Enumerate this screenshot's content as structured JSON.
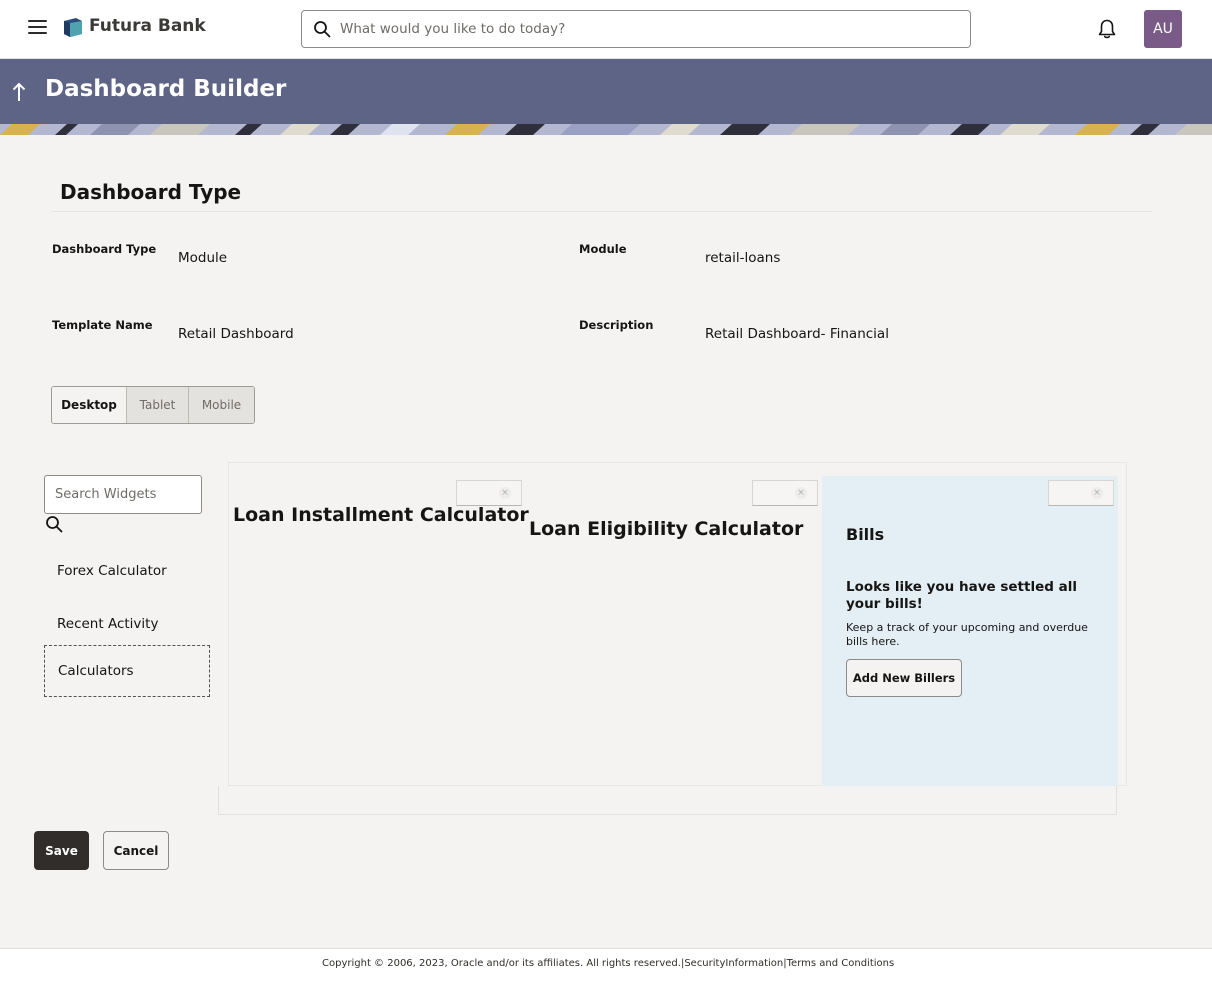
{
  "header": {
    "brand": "Futura Bank",
    "search_placeholder": "What would you like to do today?",
    "avatar_initials": "AU",
    "avatar_color": "#7a5a86"
  },
  "page": {
    "title": "Dashboard Builder",
    "section_title": "Dashboard Type"
  },
  "fields": {
    "dashboard_type_label": "Dashboard Type",
    "dashboard_type_value": "Module",
    "module_label": "Module",
    "module_value": "retail-loans",
    "template_name_label": "Template Name",
    "template_name_value": "Retail Dashboard",
    "description_label": "Description",
    "description_value": "Retail Dashboard- Financial"
  },
  "device_tabs": [
    "Desktop",
    "Tablet",
    "Mobile"
  ],
  "active_device_tab": "Desktop",
  "widgets": {
    "search_placeholder": "Search Widgets",
    "items": [
      "Forex Calculator",
      "Recent Activity",
      "Calculators"
    ],
    "selected_item": "Calculators"
  },
  "canvas": {
    "loan_installment_title": "Loan Installment Calculator",
    "loan_eligibility_title": "Loan Eligibility Calculator",
    "bills": {
      "title": "Bills",
      "message": "Looks like you have settled all your bills!",
      "subtext": "Keep a track of your upcoming and overdue bills here.",
      "button": "Add New Billers"
    },
    "close_glyph": "×"
  },
  "actions": {
    "save": "Save",
    "cancel": "Cancel"
  },
  "footer": {
    "copyright": "Copyright © 2006, 2023, Oracle and/or its affiliates. All rights reserved.",
    "separator": "|",
    "security_link": "SecurityInformation",
    "terms_link": "Terms and Conditions"
  },
  "icons": {
    "menu": "hamburger-menu-icon",
    "logo": "futura-bank-logo",
    "search": "search-icon",
    "notifications": "bell-icon",
    "back": "up-arrow-icon"
  },
  "colors": {
    "banner": "#5d6486",
    "primary_button": "#312d2a",
    "bills_card_bg": "#e3eff5"
  }
}
